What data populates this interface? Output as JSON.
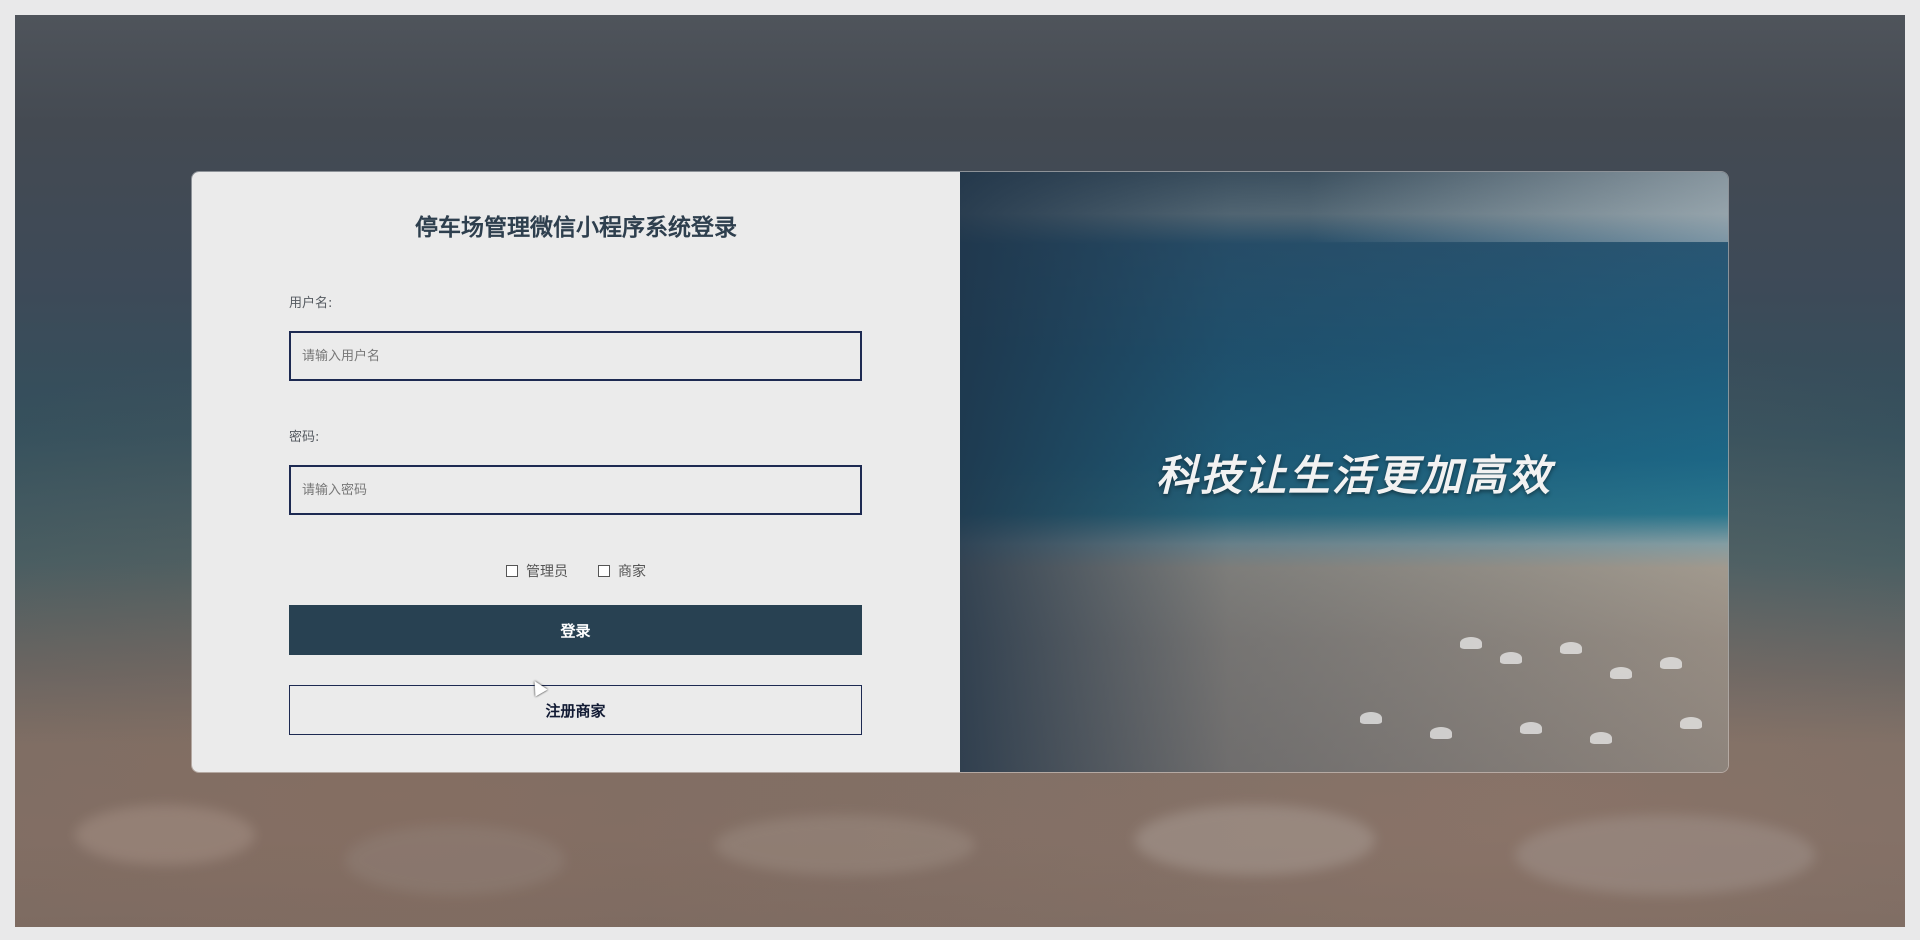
{
  "login": {
    "title": "停车场管理微信小程序系统登录",
    "username_label": "用户名:",
    "username_placeholder": "请输入用户名",
    "password_label": "密码:",
    "password_placeholder": "请输入密码",
    "roles": [
      "管理员",
      "商家"
    ],
    "login_button": "登录",
    "register_button": "注册商家"
  },
  "banner": {
    "slogan": "科技让生活更加高效"
  },
  "colors": {
    "primary": "#284152",
    "input_border": "#1d2a52",
    "panel_bg": "#ebebeb"
  }
}
